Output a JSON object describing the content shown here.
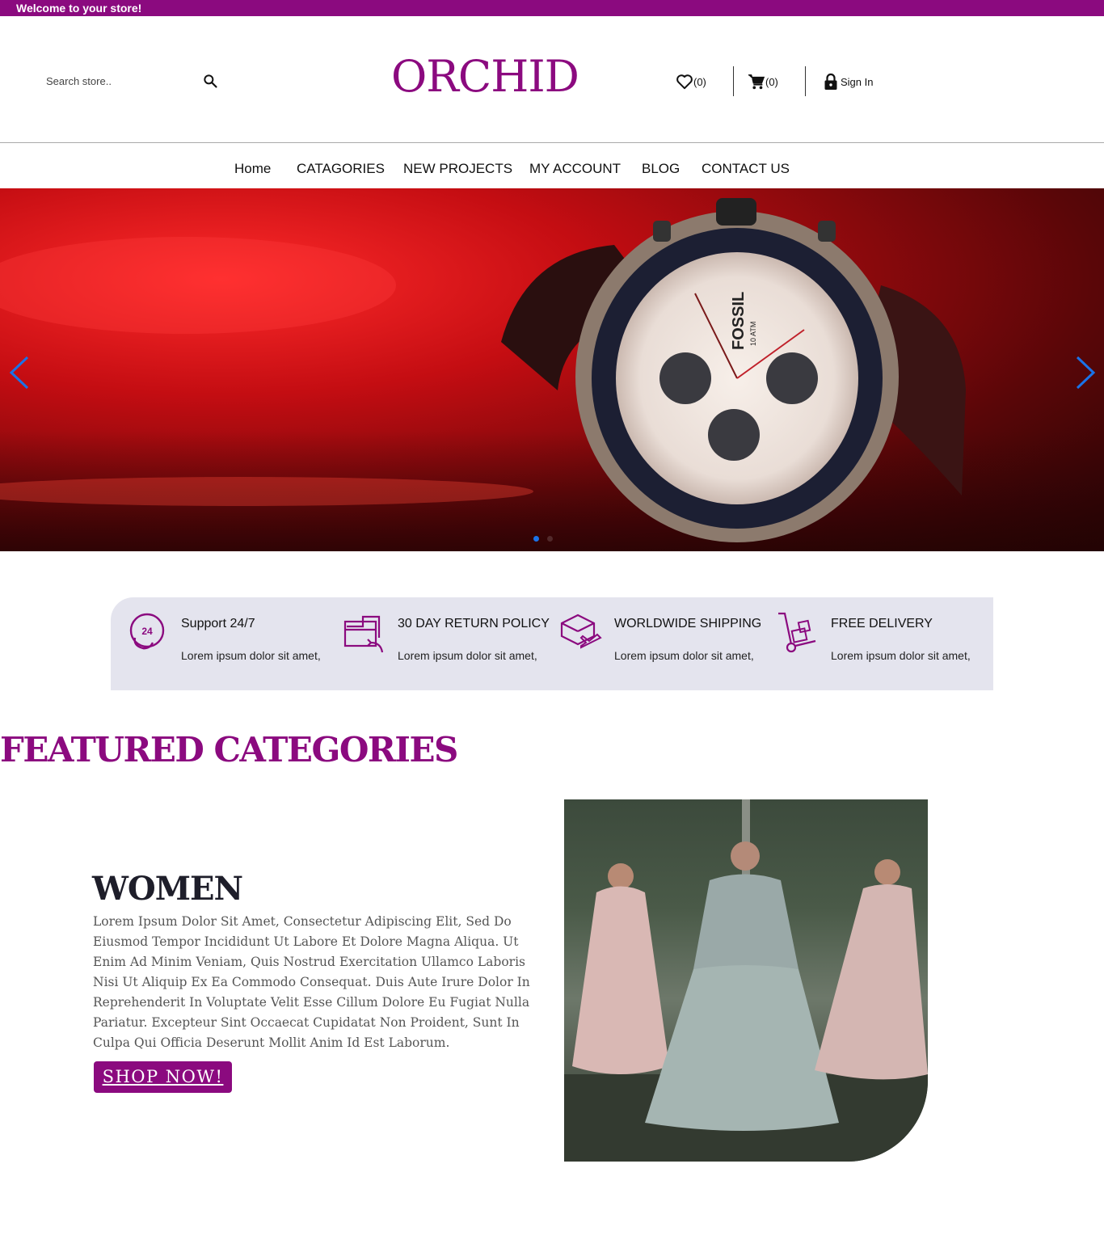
{
  "topbar": {
    "welcome": "Welcome to your store!"
  },
  "header": {
    "search_placeholder": "Search store..",
    "logo": "ORCHID",
    "wishlist_count": "(0)",
    "cart_count": "(0)",
    "signin_label": "Sign In"
  },
  "nav": {
    "items": [
      {
        "label": "Home"
      },
      {
        "label": "CATAGORIES"
      },
      {
        "label": "NEW PROJECTS"
      },
      {
        "label": "MY ACCOUNT"
      },
      {
        "label": "BLOG"
      },
      {
        "label": "CONTACT US"
      }
    ]
  },
  "hero": {
    "slide_count": 2,
    "active_slide": 1,
    "watch_brand": "FOSSIL",
    "watch_sub": "10 ATM"
  },
  "features": [
    {
      "title": "Support 24/7",
      "text": "Lorem ipsum dolor sit amet,",
      "icon": "support-24-icon"
    },
    {
      "title": "30 DAY RETURN POLICY",
      "text": "Lorem ipsum dolor sit amet,",
      "icon": "return-box-icon"
    },
    {
      "title": "WORLDWIDE SHIPPING",
      "text": "Lorem ipsum dolor sit amet,",
      "icon": "shipping-plane-icon"
    },
    {
      "title": "FREE DELIVERY",
      "text": "Lorem ipsum dolor sit amet,",
      "icon": "hand-truck-icon"
    }
  ],
  "featured": {
    "title": "FEATURED CATEGORIES",
    "category": {
      "name": "WOMEN",
      "description": "Lorem Ipsum Dolor Sit Amet, Consectetur Adipiscing Elit, Sed Do Eiusmod Tempor Incididunt Ut Labore Et Dolore Magna Aliqua. Ut Enim Ad Minim Veniam, Quis Nostrud Exercitation Ullamco Laboris Nisi Ut Aliquip Ex Ea Commodo Consequat. Duis Aute Irure Dolor In Reprehenderit In Voluptate Velit Esse Cillum Dolore Eu Fugiat Nulla Pariatur. Excepteur Sint Occaecat Cupidatat Non Proident, Sunt In Culpa Qui Officia Deserunt Mollit Anim Id Est Laborum.",
      "button": "SHOP NOW!"
    }
  },
  "colors": {
    "brand": "#8b0a7f",
    "accent": "#1a73e8",
    "feature_bg": "#e4e4ee"
  }
}
